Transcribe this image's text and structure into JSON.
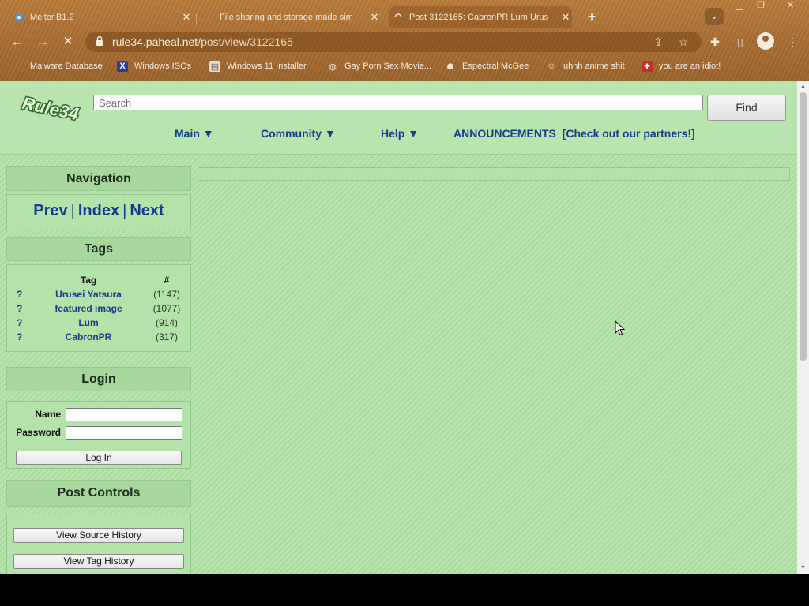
{
  "browser": {
    "tabs": [
      {
        "title": "Melter.B1.2",
        "active": false
      },
      {
        "title": "File sharing and storage made sim",
        "active": false
      },
      {
        "title": "Post 3122165: CabronPR Lum Urus",
        "active": true
      }
    ],
    "new_tab_symbol": "+",
    "url_host": "rule34.paheal.net",
    "url_path": "/post/view/3122165",
    "bookmarks": [
      {
        "label": "Malware Database",
        "icon": "melter-icon"
      },
      {
        "label": "Windows ISOs",
        "icon": "x-logo-icon"
      },
      {
        "label": "Windows 11 Installer",
        "icon": "page-icon"
      },
      {
        "label": "Gay Porn Sex Movie...",
        "icon": "globe-icon"
      },
      {
        "label": "Espectral McGee",
        "icon": "ghost-icon"
      },
      {
        "label": "uhhh anime shit",
        "icon": "face-icon"
      },
      {
        "label": "you are an idiot!",
        "icon": "flag-icon"
      }
    ]
  },
  "site": {
    "logo_text": "Rule34",
    "search": {
      "placeholder": "Search",
      "button": "Find"
    },
    "menu": [
      {
        "label": "Main ▼"
      },
      {
        "label": "Community ▼"
      },
      {
        "label": "Help ▼"
      },
      {
        "label": "ANNOUNCEMENTS  [Check out our partners!]"
      }
    ]
  },
  "sidebar": {
    "navigation": {
      "title": "Navigation",
      "prev": "Prev",
      "index": "Index",
      "next": "Next",
      "sep": "|"
    },
    "tags": {
      "title": "Tags",
      "header_tag": "Tag",
      "header_count": "#",
      "rows": [
        {
          "q": "?",
          "name": "Urusei Yatsura",
          "count": "(1147)"
        },
        {
          "q": "?",
          "name": "featured image",
          "count": "(1077)"
        },
        {
          "q": "?",
          "name": "Lum",
          "count": "(914)"
        },
        {
          "q": "?",
          "name": "CabronPR",
          "count": "(317)"
        }
      ]
    },
    "login": {
      "title": "Login",
      "name_label": "Name",
      "password_label": "Password",
      "button": "Log In"
    },
    "post_controls": {
      "title": "Post Controls",
      "source_history": "View Source History",
      "tag_history": "View Tag History"
    }
  },
  "colors": {
    "chrome": "#a86d33",
    "page_bg": "#b4e3aa",
    "link": "#133c8c"
  }
}
